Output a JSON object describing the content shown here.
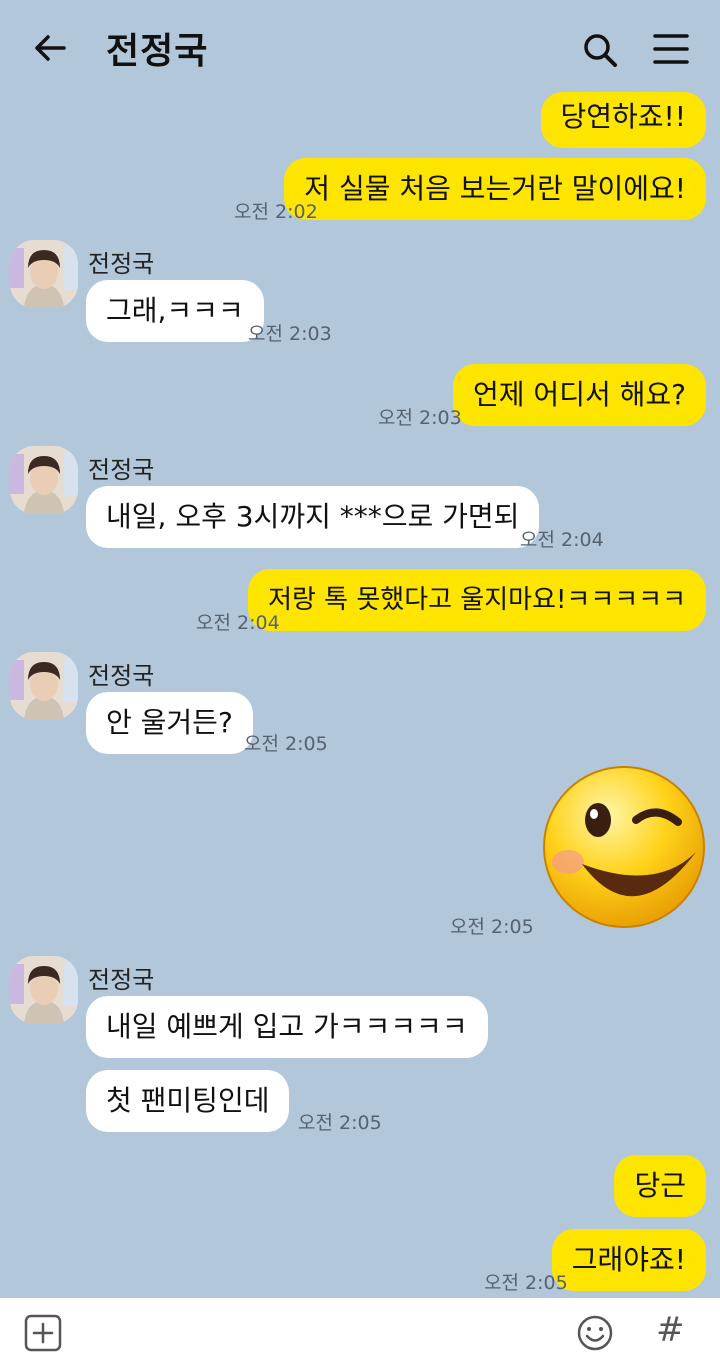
{
  "header": {
    "title": "전정국",
    "back_icon": "arrow-left-icon",
    "search_icon": "search-icon",
    "menu_icon": "hamburger-menu-icon"
  },
  "messages": [
    {
      "from": "me",
      "text": "당연하죠!!"
    },
    {
      "from": "me",
      "text": "저 실물 처음  보는거란 말이에요!",
      "time": "오전 2:02"
    },
    {
      "from": "them",
      "sender": "전정국",
      "text": "그래,ㅋㅋㅋ",
      "time": "오전 2:03"
    },
    {
      "from": "me",
      "text": "언제 어디서 해요?",
      "time": "오전 2:03"
    },
    {
      "from": "them",
      "sender": "전정국",
      "text": "내일, 오후 3시까지 ***으로 가면되",
      "time": "오전 2:04"
    },
    {
      "from": "me",
      "text": "저랑 톡 못했다고 울지마요!ㅋㅋㅋㅋㅋ",
      "time": "오전 2:04"
    },
    {
      "from": "them",
      "sender": "전정국",
      "text": "안 울거든?",
      "time": "오전 2:05"
    },
    {
      "from": "me",
      "type": "emoticon",
      "emoticon": "winking-smiley-icon",
      "time": "오전 2:05"
    },
    {
      "from": "them",
      "sender": "전정국",
      "text": "내일 예쁘게 입고 가ㅋㅋㅋㅋㅋ"
    },
    {
      "from": "them",
      "text": "첫 팬미팅인데",
      "time": "오전 2:05"
    },
    {
      "from": "me",
      "text": "당근"
    },
    {
      "from": "me",
      "text": "그래야죠!",
      "time": "오전 2:05"
    }
  ],
  "input_bar": {
    "plus_icon": "plus-square-icon",
    "emoji_icon": "smile-icon",
    "hash_label": "#"
  },
  "colors": {
    "background": "#b2c7d9",
    "my_bubble": "#fee500",
    "their_bubble": "#ffffff"
  }
}
